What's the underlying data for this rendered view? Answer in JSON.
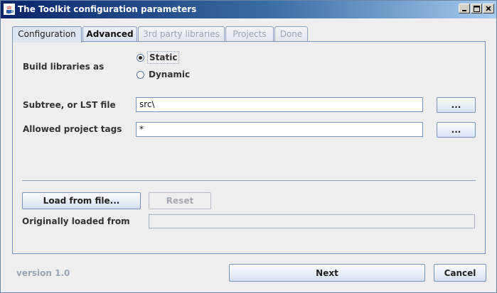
{
  "window": {
    "title": "The Toolkit configuration parameters",
    "controls": [
      "minimize-icon",
      "maximize-icon",
      "close-icon"
    ]
  },
  "tabs": [
    {
      "label": "Configuration",
      "state": "selected"
    },
    {
      "label": "Advanced",
      "state": "enabled"
    },
    {
      "label": "3rd party libraries",
      "state": "disabled"
    },
    {
      "label": "Projects",
      "state": "disabled"
    },
    {
      "label": "Done",
      "state": "disabled"
    }
  ],
  "config": {
    "build_label": "Build libraries as",
    "build_options": [
      {
        "label": "Static",
        "selected": true
      },
      {
        "label": "Dynamic",
        "selected": false
      }
    ],
    "subtree_label": "Subtree, or LST file",
    "subtree_value": "src\\",
    "subtree_browse": "...",
    "tags_label": "Allowed project tags",
    "tags_value": "*",
    "tags_browse": "...",
    "load_button": "Load from file...",
    "reset_button": "Reset",
    "loaded_from_label": "Originally loaded from",
    "loaded_from_value": ""
  },
  "footer": {
    "version": "version 1.0",
    "next_button": "Next",
    "cancel_button": "Cancel"
  },
  "colors": {
    "title_gradient_start": "#0a246a",
    "title_gradient_end": "#a6caf0",
    "border_accent": "#7a93bd"
  }
}
